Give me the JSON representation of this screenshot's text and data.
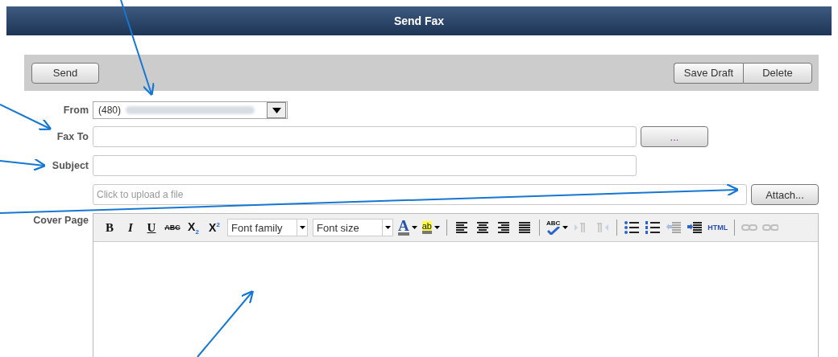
{
  "window": {
    "title": "Send Fax"
  },
  "action_bar": {
    "left_buttons": [
      "Send"
    ],
    "right_buttons": [
      "Save Draft",
      "Delete"
    ]
  },
  "form": {
    "from": {
      "label": "From",
      "value": "(480)",
      "redacted": true
    },
    "fax_to": {
      "label": "Fax To",
      "browse_button": "..."
    },
    "subject": {
      "label": "Subject"
    },
    "attachment": {
      "placeholder": "Click to upload a file",
      "button": "Attach..."
    },
    "cover_page": {
      "label": "Cover Page"
    }
  },
  "editor": {
    "toolbar": [
      {
        "kind": "bold",
        "label": "B",
        "disabled": false
      },
      {
        "kind": "italic",
        "label": "I",
        "disabled": false
      },
      {
        "kind": "underline",
        "label": "U",
        "disabled": false
      },
      {
        "kind": "strike",
        "label": "ABC",
        "disabled": false
      },
      {
        "kind": "subscript",
        "label": "X$_{2}$",
        "disabled": false
      },
      {
        "kind": "superscript",
        "label": "X$^{2}$",
        "disabled": false
      },
      {
        "kind": "select",
        "label": "Font family"
      },
      {
        "kind": "select",
        "label": "Font size"
      },
      {
        "kind": "forecolor",
        "label": "A",
        "menu": true,
        "disabled": false
      },
      {
        "kind": "hilite",
        "label": "ab",
        "menu": true,
        "disabled": false
      },
      {
        "kind": "separator"
      },
      {
        "kind": "align-left",
        "disabled": false
      },
      {
        "kind": "align-center",
        "disabled": false
      },
      {
        "kind": "align-right",
        "disabled": false
      },
      {
        "kind": "justify",
        "disabled": false
      },
      {
        "kind": "separator"
      },
      {
        "kind": "spellcheck",
        "label": "ABC",
        "menu": true,
        "disabled": false
      },
      {
        "kind": "ltr",
        "disabled": true
      },
      {
        "kind": "rtl",
        "disabled": true
      },
      {
        "kind": "separator"
      },
      {
        "kind": "bullets",
        "disabled": false
      },
      {
        "kind": "numbers",
        "disabled": false
      },
      {
        "kind": "outdent",
        "disabled": true
      },
      {
        "kind": "indent",
        "disabled": false
      },
      {
        "kind": "html",
        "label": "HTML",
        "disabled": false
      },
      {
        "kind": "separator"
      },
      {
        "kind": "link",
        "disabled": true
      },
      {
        "kind": "unlink",
        "disabled": true
      }
    ]
  }
}
